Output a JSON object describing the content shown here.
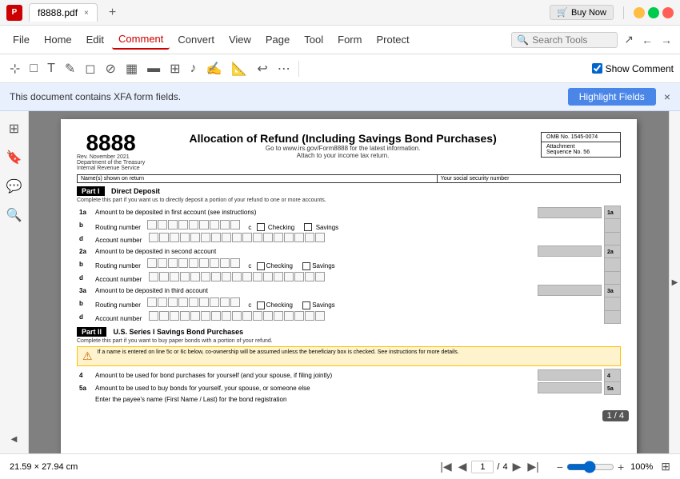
{
  "titlebar": {
    "app_icon": "P",
    "file_name": "f8888.pdf",
    "close_tab": "×",
    "new_tab": "+",
    "buy_now": "Buy Now",
    "minimize": "−",
    "maximize": "□",
    "close": "×"
  },
  "menubar": {
    "items": [
      "File",
      "Home",
      "Edit",
      "Comment",
      "Convert",
      "View",
      "Page",
      "Tool",
      "Form",
      "Protect"
    ],
    "active": "Comment",
    "search_placeholder": "Search Tools",
    "nav_back": "←",
    "nav_forward": "→"
  },
  "toolbar": {
    "show_comment_label": "Show Comment"
  },
  "xfa_banner": {
    "message": "This document contains XFA form fields.",
    "button": "Highlight Fields",
    "close": "×"
  },
  "pdf": {
    "form_number": "8888",
    "form_rev": "Rev. November 2021",
    "form_dept": "Department of the Treasury",
    "form_irs": "Internal Revenue Service",
    "title": "Allocation of Refund (Including Savings Bond Purchases)",
    "go_to": "Go to www.irs.gov/Form8888 for the latest information.",
    "attach": "Attach to your income tax return.",
    "omb": "OMB No. 1545-0074",
    "attachment": "Attachment",
    "sequence": "Sequence No. 56",
    "name_label": "Name(s) shown on return",
    "ssn_label": "Your social security number",
    "part1_label": "Part I",
    "part1_title": "Direct Deposit",
    "part1_desc": "Complete this part if you want us to directly deposit a portion of your refund to one or more accounts.",
    "row_1a_label": "1a",
    "row_1a_text": "Amount to be deposited in first account (see instructions)",
    "row_b1": "b",
    "routing_label": "Routing number",
    "row_c": "c",
    "checking_label": "Checking",
    "savings_label": "Savings",
    "row_d1": "d",
    "account_label": "Account number",
    "row_2a_label": "2a",
    "row_2a_text": "Amount to be deposited in second account",
    "row_b2": "b",
    "row_d2": "d",
    "row_3a_label": "3a",
    "row_3a_text": "Amount to be deposited in third account",
    "row_b3": "b",
    "row_d3": "d",
    "part2_label": "Part II",
    "part2_title": "U.S. Series I Savings Bond Purchases",
    "part2_desc": "Complete this part if you want to buy paper bonds with a portion of your refund.",
    "warning_text": "If a name is entered on line 5c or 6c below, co-ownership will be assumed unless the beneficiary box is checked. See instructions for more details.",
    "row_4_label": "4",
    "row_4_text": "Amount to be used for bond purchases for yourself (and your spouse, if filing jointly)",
    "row_5a_label": "5a",
    "row_5a_text": "Amount to be used to buy bonds for yourself, your spouse, or someone else",
    "row_5b_text": "Enter the payee's name (First Name / Last) for the bond registration"
  },
  "page_info": {
    "current": "1",
    "total": "4",
    "badge": "1 / 4"
  },
  "zoom": {
    "level": "100%"
  },
  "doc_size": "21.59 × 27.94 cm"
}
